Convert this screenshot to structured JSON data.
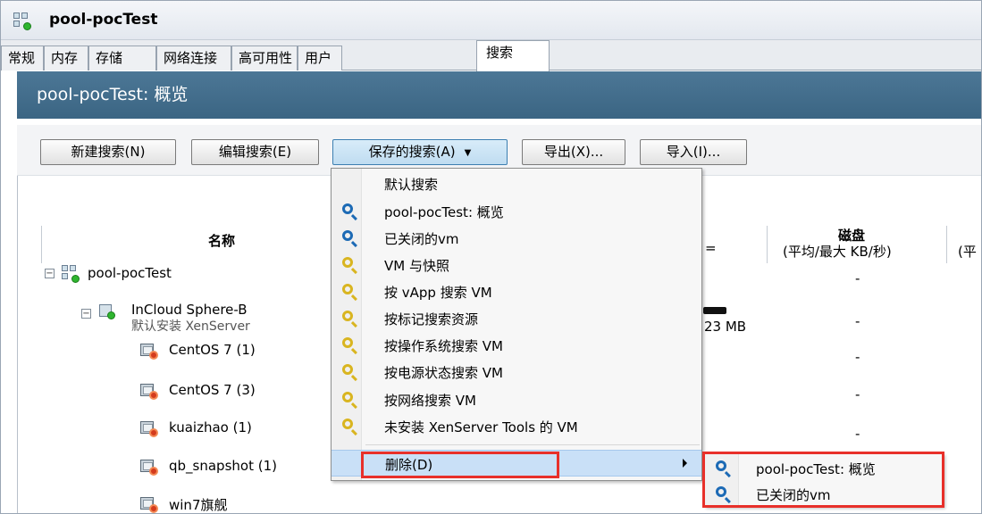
{
  "window": {
    "title": "pool-pocTest"
  },
  "tabs": [
    {
      "label": "常规",
      "active": false
    },
    {
      "label": "内存",
      "active": false
    },
    {
      "label": "存储",
      "active": false
    },
    {
      "label": "网络连接",
      "active": false
    },
    {
      "label": "高可用性",
      "active": false
    },
    {
      "label": "用户",
      "active": false
    },
    {
      "label": "搜索",
      "active": true
    }
  ],
  "banner": {
    "title": "pool-pocTest: 概览"
  },
  "toolbar": {
    "new_search": "新建搜索(N)",
    "edit_search": "编辑搜索(E)",
    "saved_searches": "保存的搜索(A)",
    "export": "导出(X)...",
    "import": "导入(I)..."
  },
  "table": {
    "col_name": "名称",
    "col_disk": "磁盘",
    "col_disk_sub": "(平均/最大 KB/秒)",
    "col_next_sub": "(平",
    "partial_header": "=",
    "memory_value": "23 MB",
    "dash": "-"
  },
  "tree": {
    "pool": "pool-pocTest",
    "host_name": "InCloud Sphere-B",
    "host_desc": "默认安装 XenServer",
    "vms": [
      "CentOS 7 (1)",
      "CentOS 7 (3)",
      "kuaizhao (1)",
      "qb_snapshot (1)",
      "win7旗舰"
    ]
  },
  "menu": {
    "items": [
      {
        "label": "默认搜索",
        "icon": "none"
      },
      {
        "label": "pool-pocTest: 概览",
        "icon": "magnifier-blue-icon"
      },
      {
        "label": "已关闭的vm",
        "icon": "magnifier-blue-icon"
      },
      {
        "label": "VM 与快照",
        "icon": "magnifier-yellow-icon"
      },
      {
        "label": "按 vApp 搜索 VM",
        "icon": "magnifier-yellow-icon"
      },
      {
        "label": "按标记搜索资源",
        "icon": "magnifier-yellow-icon"
      },
      {
        "label": "按操作系统搜索 VM",
        "icon": "magnifier-yellow-icon"
      },
      {
        "label": "按电源状态搜索 VM",
        "icon": "magnifier-yellow-icon"
      },
      {
        "label": "按网络搜索 VM",
        "icon": "magnifier-yellow-icon"
      },
      {
        "label": "未安装 XenServer Tools 的 VM",
        "icon": "magnifier-yellow-icon"
      }
    ],
    "delete_label": "删除(D)"
  },
  "submenu": {
    "items": [
      {
        "label": "pool-pocTest: 概览",
        "icon": "magnifier-blue-icon"
      },
      {
        "label": "已关闭的vm",
        "icon": "magnifier-blue-icon"
      }
    ]
  },
  "colors": {
    "banner": "#3f6a89",
    "menu_highlight": "#c9e0f7",
    "annotation_red": "#e8302a",
    "icon_blue": "#1c6ab5",
    "icon_yellow": "#d9b520"
  }
}
